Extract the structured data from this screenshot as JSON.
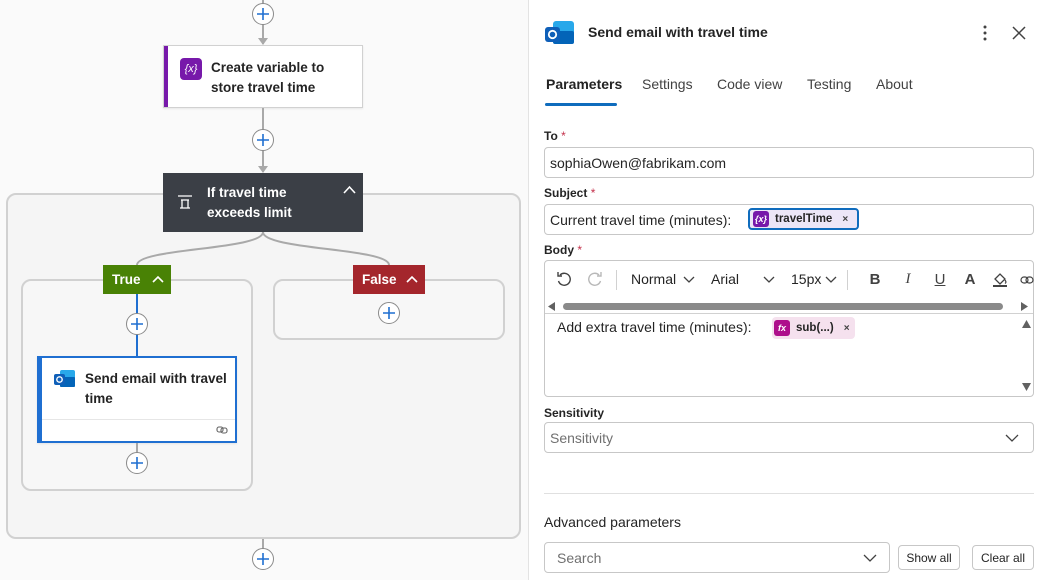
{
  "canvas": {
    "create_variable_card": {
      "title_line1": "Create variable to",
      "title_line2": "store travel time"
    },
    "condition_card": {
      "title_line1": "If travel time",
      "title_line2": "exceeds limit"
    },
    "true_branch": {
      "label": "True",
      "color": "#498205"
    },
    "false_branch": {
      "label": "False",
      "color": "#a4262c"
    },
    "email_card": {
      "title_line1": "Send email with travel",
      "title_line2": "time"
    }
  },
  "panel": {
    "title": "Send email with travel time",
    "tabs": [
      {
        "label": "Parameters"
      },
      {
        "label": "Settings"
      },
      {
        "label": "Code view"
      },
      {
        "label": "Testing"
      },
      {
        "label": "About"
      }
    ],
    "to": {
      "label": "To",
      "required_mark": "*",
      "value": "sophiaOwen@fabrikam.com"
    },
    "subject": {
      "label": "Subject",
      "required_mark": "*",
      "prefix": "Current travel time (minutes):",
      "token": {
        "label": "travelTime",
        "icon_text": "{x}",
        "remove": "×",
        "color": "#7719aa"
      }
    },
    "body": {
      "label": "Body",
      "required_mark": "*",
      "toolbar": {
        "style": "Normal",
        "font": "Arial",
        "size": "15px",
        "bold": "B",
        "italic": "I",
        "underline": "U",
        "font_color": "A"
      },
      "text": "Add extra travel time (minutes):",
      "token": {
        "label": "sub(...)",
        "icon_text": "fx",
        "remove": "×",
        "color": "#ae0f8c"
      }
    },
    "sensitivity": {
      "label": "Sensitivity",
      "placeholder": "Sensitivity"
    },
    "advanced": {
      "title": "Advanced parameters",
      "search_placeholder": "Search",
      "show_all": "Show all",
      "clear_all": "Clear all"
    },
    "accent_color": "#0f6cbd"
  }
}
